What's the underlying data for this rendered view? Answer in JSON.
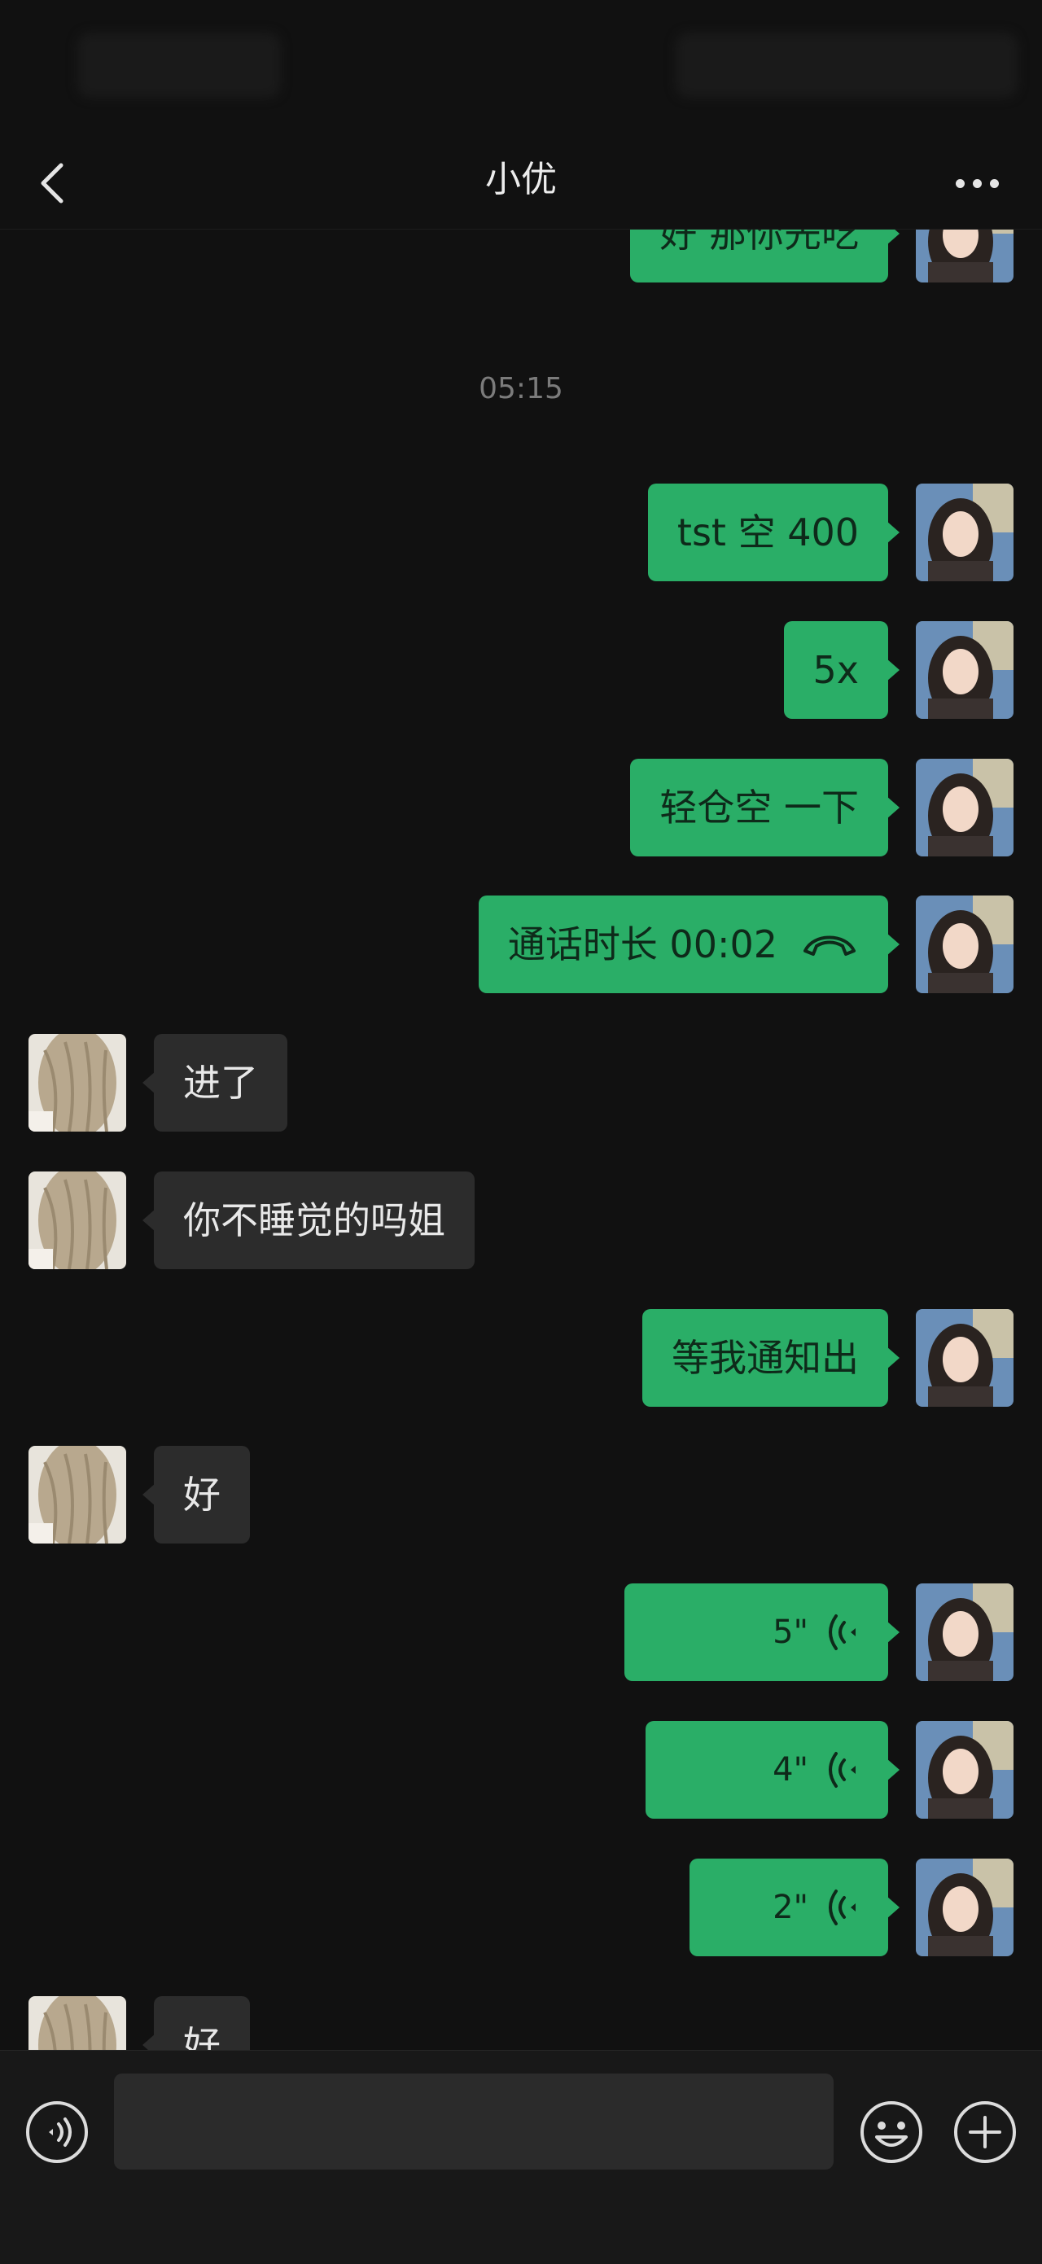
{
  "header": {
    "title": "小优"
  },
  "timestamps": [
    "05:15"
  ],
  "messages": [
    {
      "side": "sent",
      "text": "好 那你先吃"
    },
    {
      "side": "sent",
      "text": "tst 空 400"
    },
    {
      "side": "sent",
      "text": "5x"
    },
    {
      "side": "sent",
      "text": "轻仓空 一下"
    },
    {
      "side": "sent",
      "text": "通话时长 00:02"
    },
    {
      "side": "recv",
      "text": "进了"
    },
    {
      "side": "recv",
      "text": "你不睡觉的吗姐"
    },
    {
      "side": "sent",
      "text": "等我通知出"
    },
    {
      "side": "recv",
      "text": "好"
    },
    {
      "side": "sent",
      "text": "5\"",
      "voice_seconds": 5
    },
    {
      "side": "sent",
      "text": "4\"",
      "voice_seconds": 4
    },
    {
      "side": "sent",
      "text": "2\"",
      "voice_seconds": 2
    },
    {
      "side": "recv",
      "text": "好"
    }
  ],
  "input": {
    "placeholder": ""
  },
  "colors": {
    "background": "#111111",
    "sent_bubble": "#2aae67",
    "recv_bubble": "#2c2c2c",
    "timestamp": "#7b7b7b"
  },
  "icons": {
    "back": "chevron-left-icon",
    "more": "more-dots-icon",
    "hangup": "phone-hangup-icon",
    "voice": "voice-wave-icon",
    "voice_toggle": "voice-toggle-icon",
    "emoji": "emoji-icon",
    "plus": "plus-circle-icon"
  }
}
